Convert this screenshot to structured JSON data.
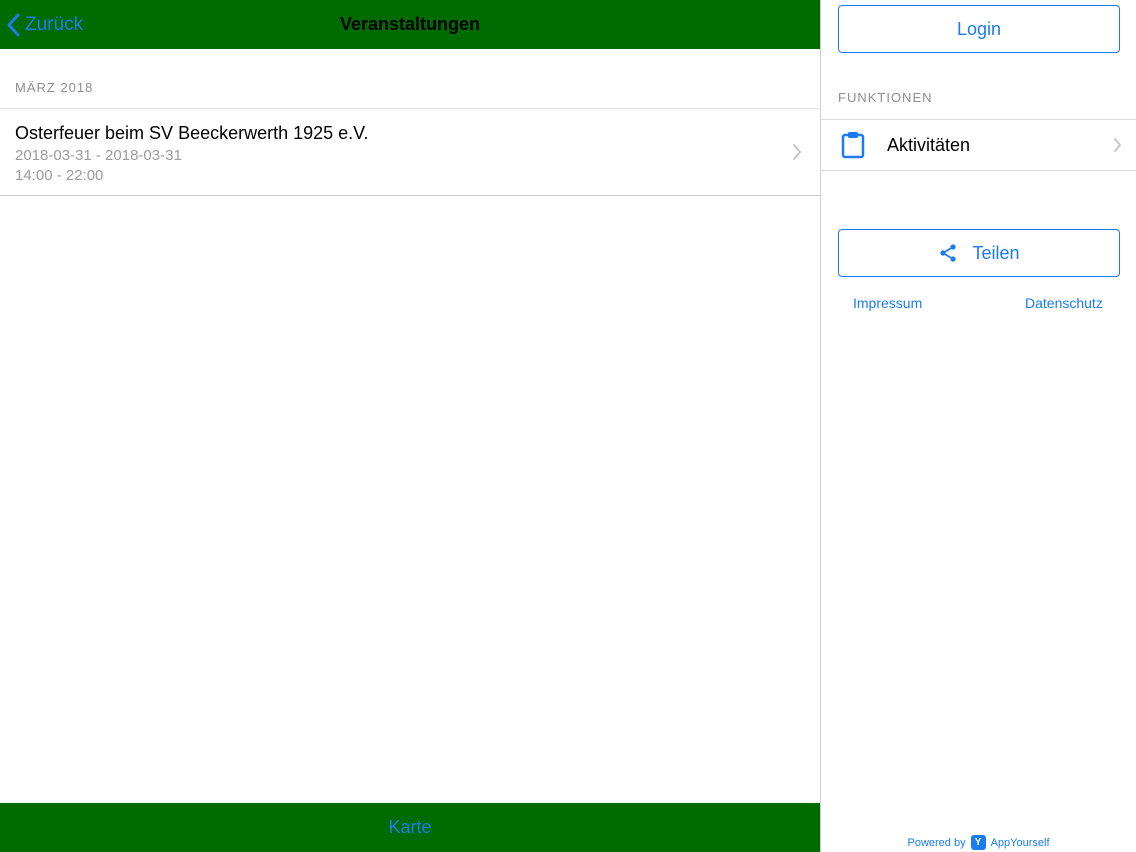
{
  "navbar": {
    "back_label": "Zurück",
    "title": "Veranstaltungen"
  },
  "events": {
    "section_header": "MÄRZ 2018",
    "items": [
      {
        "title": "Osterfeuer beim SV Beeckerwerth 1925 e.V.",
        "date": "2018-03-31 - 2018-03-31",
        "time": "14:00 - 22:00"
      }
    ]
  },
  "tabbar": {
    "label": "Karte"
  },
  "sidebar": {
    "login_label": "Login",
    "section_header": "FUNKTIONEN",
    "activity_label": "Aktivitäten",
    "share_label": "Teilen",
    "impressum_label": "Impressum",
    "datenschutz_label": "Datenschutz",
    "powered_prefix": "Powered by",
    "powered_brand": "AppYourself",
    "powered_logo_letter": "Y"
  },
  "colors": {
    "accent": "#1a7cf0",
    "navbar_green": "#006b00"
  },
  "icons": {
    "back": "chevron-left-icon",
    "row": "chevron-right-icon",
    "activity": "clipboard-icon",
    "share": "share-icon"
  }
}
